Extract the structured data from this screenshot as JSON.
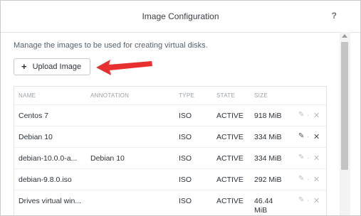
{
  "dialog": {
    "title": "Image Configuration",
    "help_label": "?"
  },
  "description": "Manage the images to be used for creating virtual disks.",
  "upload_button": {
    "label": "Upload Image",
    "icon": "plus-icon"
  },
  "table": {
    "columns": [
      "NAME",
      "ANNOTATION",
      "TYPE",
      "STATE",
      "SIZE"
    ],
    "rows": [
      {
        "name": "Centos 7",
        "annotation": "",
        "type": "ISO",
        "state": "ACTIVE",
        "size": "918 MiB",
        "size2": "",
        "hover": false
      },
      {
        "name": "Debian 10",
        "annotation": "",
        "type": "ISO",
        "state": "ACTIVE",
        "size": "334 MiB",
        "size2": "",
        "hover": true
      },
      {
        "name": "debian-10.0.0-a...",
        "annotation": "Debian 10",
        "type": "ISO",
        "state": "ACTIVE",
        "size": "334 MiB",
        "size2": "",
        "hover": false
      },
      {
        "name": "debian-9.8.0.iso",
        "annotation": "",
        "type": "ISO",
        "state": "ACTIVE",
        "size": "292 MiB",
        "size2": "",
        "hover": false
      },
      {
        "name": "Drives virtual win...",
        "annotation": "",
        "type": "ISO",
        "state": "ACTIVE",
        "size": "46.44",
        "size2": "MiB",
        "hover": false
      }
    ],
    "actions": {
      "edit_icon": "pencil-icon",
      "separator": "·",
      "delete_icon": "close-icon"
    }
  },
  "colors": {
    "arrow": "#e8312f",
    "border": "#c9c9c9"
  }
}
